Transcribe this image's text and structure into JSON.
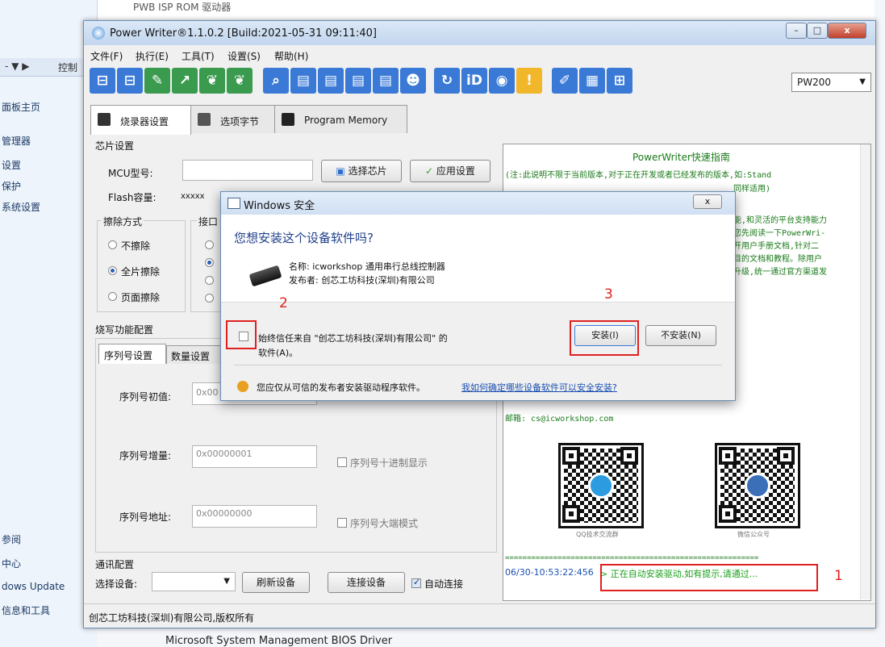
{
  "background": {
    "top_text": "PWB ISP ROM 驱动器",
    "address_text": "控制",
    "side_links": [
      "面板主页",
      "管理器",
      "设置",
      "保护",
      "系统设置",
      "参阅",
      "中心",
      "dows Update",
      "信息和工具"
    ],
    "bottom_text": "Microsoft System Management BIOS Driver"
  },
  "window": {
    "title": "Power Writer®1.1.0.2 [Build:2021-05-31 09:11:40]",
    "minimize": "–",
    "maximize": "□",
    "close": "x"
  },
  "menu": [
    "文件(F)",
    "执行(E)",
    "工具(T)",
    "设置(S)",
    "帮助(H)"
  ],
  "toolbar": {
    "device": "PW200"
  },
  "tabs": [
    {
      "label": "烧录器设置"
    },
    {
      "label": "选项字节"
    },
    {
      "label": "Program Memory"
    }
  ],
  "chip": {
    "group_title": "芯片设置",
    "mcu_label": "MCU型号:",
    "select_chip_btn": "选择芯片",
    "apply_btn": "应用设置",
    "flash_label": "Flash容量:",
    "flash_value": "xxxxx"
  },
  "erase": {
    "group_title": "擦除方式",
    "options": [
      "不擦除",
      "全片擦除",
      "页面擦除"
    ],
    "interface_title": "接口"
  },
  "burn": {
    "group_title": "烧写功能配置",
    "tab1": "序列号设置",
    "tab2": "数量设置"
  },
  "serial": {
    "init_label": "序列号初值:",
    "init_value": "0x00",
    "inc_label": "序列号增量:",
    "inc_value": "0x00000001",
    "inc_check": "序列号十进制显示",
    "addr_label": "序列号地址:",
    "addr_value": "0x00000000",
    "addr_check": "序列号大端模式"
  },
  "comm": {
    "group_title": "通讯配置",
    "select_label": "选择设备:",
    "refresh_btn": "刷新设备",
    "connect_btn": "连接设备",
    "auto_label": "自动连接"
  },
  "status_bar": "创芯工坊科技(深圳)有限公司,版权所有",
  "guide": {
    "title": "PowerWriter快速指南",
    "line1": "(注:此说明不限于当前版本,对于正在开发或者已经发布的版本,如:Stand",
    "line1b": "同样适用)",
    "lines_right": [
      "能,和灵活的平台支持能力",
      "您先阅读一下PowerWri-",
      "开用户手册文档,针对二",
      "目的文档和教程。除用户",
      "升级,统一通过官方渠道发"
    ],
    "email": "邮箱: cs@icworkshop.com",
    "qr1_caption": "QQ技术交流群",
    "qr2_caption": "微信公众号",
    "dash_line": "==========================================================",
    "log_time": "06/30-10:53:22:456",
    "log_msg": "> 正在自动安装驱动,如有提示,请通过..."
  },
  "dialog": {
    "title": "Windows 安全",
    "close": "x",
    "question": "您想安装这个设备软件吗?",
    "name_line": "名称: icworkshop 通用串行总线控制器",
    "publisher_line": "发布者: 创芯工坊科技(深圳)有限公司",
    "trust_text": "始终信任来自 \"创芯工坊科技(深圳)有限公司\" 的",
    "trust_text2": "软件(A)。",
    "install_btn": "安装(I)",
    "no_install_btn": "不安装(N)",
    "warning_text": "您应仅从可信的发布者安装驱动程序软件。",
    "link_text": "我如何确定哪些设备软件可以安全安装?"
  },
  "annotations": [
    "1",
    "2",
    "3"
  ],
  "colors": {
    "annotation_red": "#e02020",
    "log_green": "#1a7a1a",
    "toolbar_blue": "#3a7ad6",
    "toolbar_green": "#3a9a4e",
    "link_blue": "#1a4fb0"
  }
}
